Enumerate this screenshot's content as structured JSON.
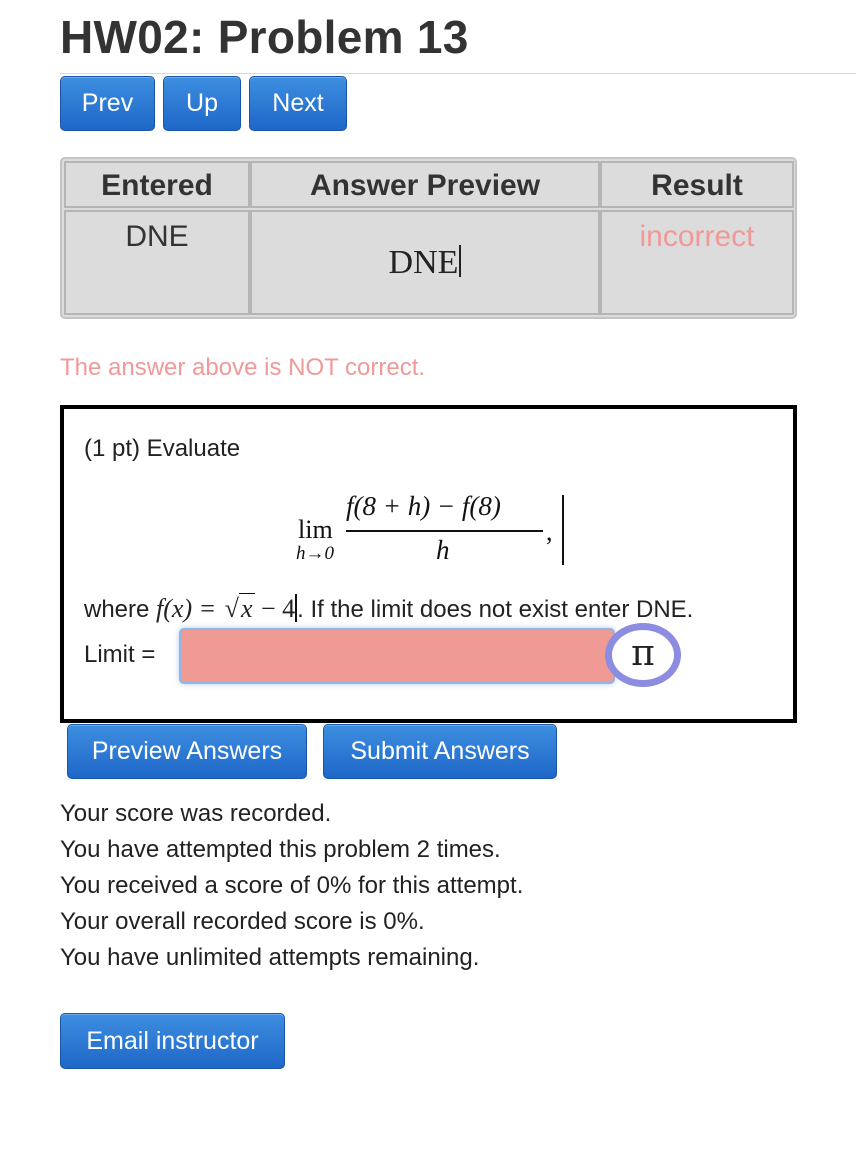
{
  "page": {
    "title": "HW02: Problem 13"
  },
  "nav": {
    "prev_label": "Prev",
    "up_label": "Up",
    "next_label": "Next"
  },
  "results_table": {
    "headers": [
      "Entered",
      "Answer Preview",
      "Result"
    ],
    "rows": [
      {
        "entered": "DNE",
        "preview": "DNE",
        "result": "incorrect"
      }
    ]
  },
  "feedback": {
    "message": "The answer above is NOT correct."
  },
  "problem": {
    "intro": "(1 pt) Evaluate",
    "math": {
      "lim": "lim",
      "lim_sub": "h→0",
      "numerator": "f(8 + h) − f(8)",
      "denominator": "h",
      "trailing": ","
    },
    "where_prefix": "where ",
    "f_def_lhs": "f(x) = ",
    "sqrt_symbol": "√",
    "sqrt_arg": "x",
    "f_def_rest": " − 4",
    "where_suffix": ". If the limit does not exist enter DNE.",
    "limit_label": "Limit =",
    "answer_value": "",
    "pi_label": "π"
  },
  "actions": {
    "preview_label": "Preview Answers",
    "submit_label": "Submit Answers"
  },
  "score": {
    "lines": [
      "Your score was recorded.",
      "You have attempted this problem 2 times.",
      "You received a score of 0% for this attempt.",
      "Your overall recorded score is 0%.",
      "You have unlimited attempts remaining."
    ]
  },
  "email": {
    "label": "Email instructor"
  },
  "colors": {
    "button_blue": "#2a78d6",
    "incorrect_text": "#f19999",
    "input_error_bg": "#f09a95",
    "pi_ring": "#8c8ce0"
  }
}
